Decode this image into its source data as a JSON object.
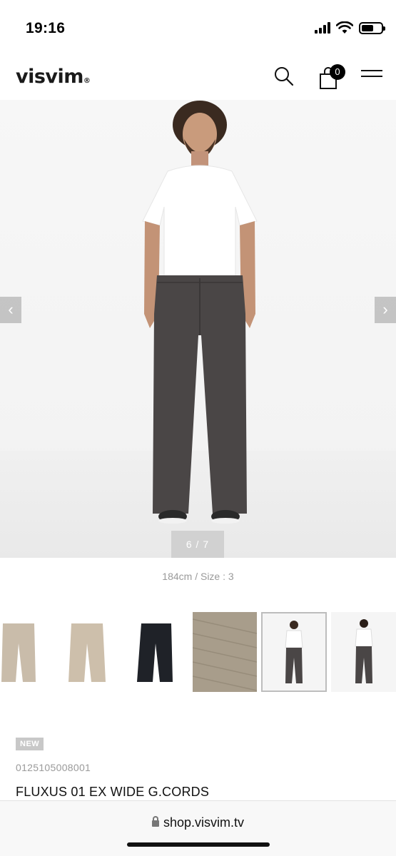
{
  "status_bar": {
    "time": "19:16",
    "battery_level": 0.6
  },
  "header": {
    "logo": "visvim",
    "logo_mark": "®",
    "cart_count": "0"
  },
  "gallery": {
    "counter": "6 / 7",
    "prev_glyph": "‹",
    "next_glyph": "›",
    "caption": "184cm / Size : 3",
    "thumbnails": [
      {
        "desc": "beige-pants-front"
      },
      {
        "desc": "beige-pants-back"
      },
      {
        "desc": "black-pants"
      },
      {
        "desc": "fabric-detail"
      },
      {
        "desc": "model-front",
        "active": true
      },
      {
        "desc": "model-back"
      }
    ]
  },
  "product": {
    "badge": "NEW",
    "sku": "0125105008001",
    "title": "FLUXUS 01 EX WIDE G.CORDS"
  },
  "browser": {
    "url": "shop.visvim.tv"
  },
  "colors": {
    "pants": "#4a4646",
    "shirt": "#ffffff",
    "beige": "#c9bcaa",
    "black_pants": "#1f2228"
  }
}
